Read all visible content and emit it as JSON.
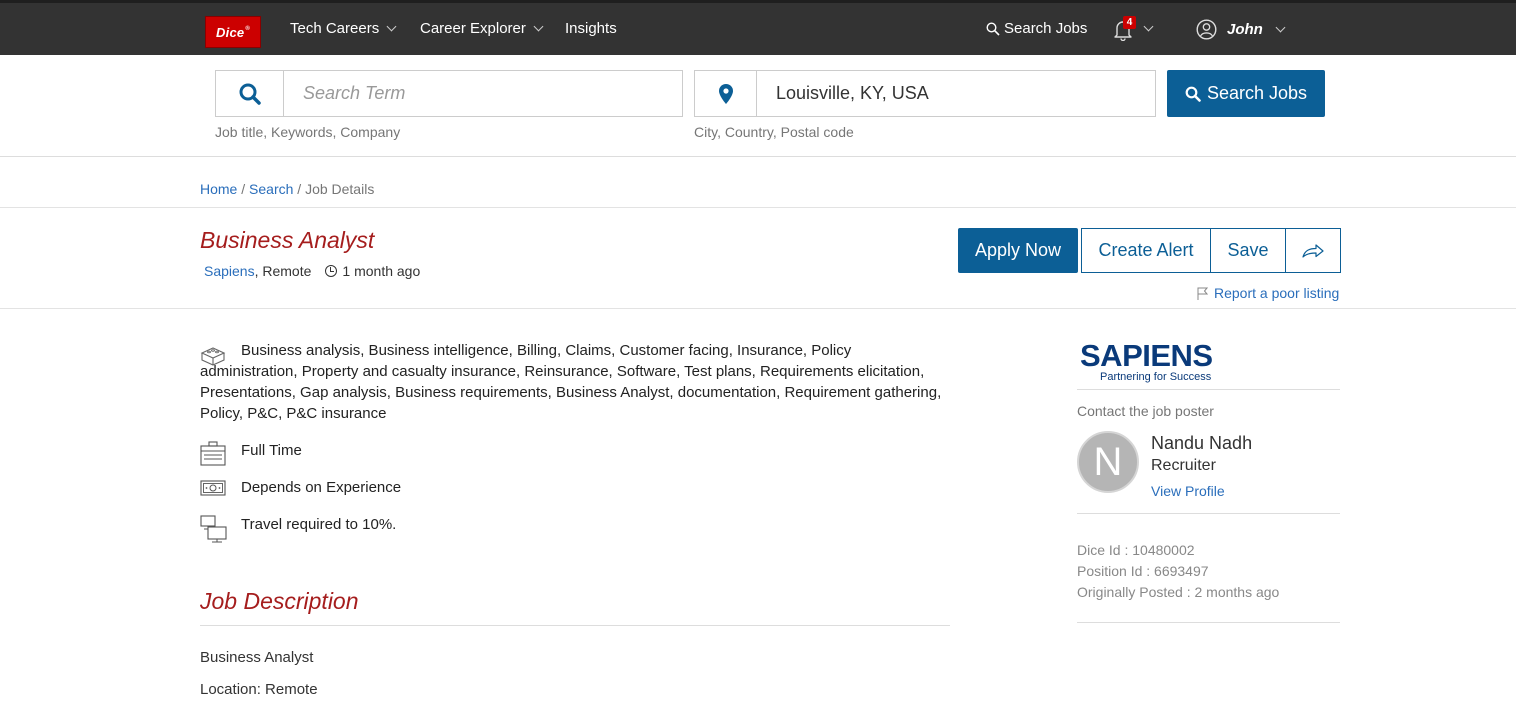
{
  "nav": {
    "logo": "Dice",
    "items": [
      {
        "label": "Tech Careers"
      },
      {
        "label": "Career Explorer"
      },
      {
        "label": "Insights"
      }
    ],
    "search_jobs": "Search Jobs",
    "notification_count": "4",
    "user_name": "John"
  },
  "search": {
    "term_placeholder": "Search Term",
    "term_hint": "Job title, Keywords, Company",
    "location_value": "Louisville, KY, USA",
    "location_hint": "City, Country, Postal code",
    "button_label": "Search Jobs"
  },
  "breadcrumb": {
    "home": "Home",
    "search": "Search",
    "current": "Job Details"
  },
  "job": {
    "title": "Business Analyst",
    "company": "Sapiens",
    "location": "Remote",
    "posted": "1 month ago",
    "apply_label": "Apply Now",
    "create_alert_label": "Create Alert",
    "save_label": "Save",
    "report_label": "Report a poor listing",
    "skills": "Business analysis, Business intelligence, Billing, Claims, Customer facing, Insurance, Policy administration, Property and casualty insurance, Reinsurance, Software, Test plans, Requirements elicitation, Presentations, Gap analysis, Business requirements, Business Analyst, documentation, Requirement gathering, Policy, P&C, P&C insurance",
    "employment_type": "Full Time",
    "compensation": "Depends on Experience",
    "travel": "Travel required to 10%.",
    "description_title": "Job Description",
    "description_lines": [
      "Business Analyst",
      "Location: Remote"
    ]
  },
  "sidebar": {
    "company_logo_name": "SAPIENS",
    "company_tagline": "Partnering for Success",
    "contact_label": "Contact the job poster",
    "avatar_initial": "N",
    "recruiter_name": "Nandu Nadh",
    "recruiter_role": "Recruiter",
    "view_profile": "View Profile",
    "dice_id": "Dice Id : 10480002",
    "position_id": "Position Id : 6693497",
    "originally_posted": "Originally Posted : 2 months ago"
  },
  "colors": {
    "nav_bg": "#333333",
    "brand_blue": "#0c5f96",
    "title_red": "#a51d1d",
    "link_blue": "#2a6ebb",
    "logo_red": "#cc0000"
  },
  "icons": [
    "search-icon",
    "location-pin-icon",
    "bell-icon",
    "user-icon",
    "clock-icon",
    "share-icon",
    "flag-icon",
    "skills-icon",
    "briefcase-icon",
    "money-icon",
    "travel-icon"
  ]
}
